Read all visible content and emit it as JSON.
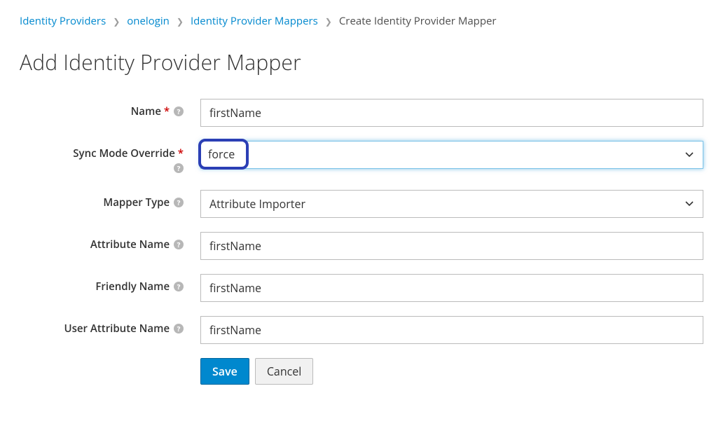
{
  "breadcrumb": {
    "items": [
      {
        "label": "Identity Providers",
        "link": true
      },
      {
        "label": "onelogin",
        "link": true
      },
      {
        "label": "Identity Provider Mappers",
        "link": true
      },
      {
        "label": "Create Identity Provider Mapper",
        "link": false
      }
    ]
  },
  "page": {
    "title": "Add Identity Provider Mapper"
  },
  "form": {
    "name": {
      "label": "Name",
      "value": "firstName"
    },
    "syncMode": {
      "label": "Sync Mode Override",
      "value": "force"
    },
    "mapperType": {
      "label": "Mapper Type",
      "value": "Attribute Importer"
    },
    "attributeName": {
      "label": "Attribute Name",
      "value": "firstName"
    },
    "friendlyName": {
      "label": "Friendly Name",
      "value": "firstName"
    },
    "userAttributeName": {
      "label": "User Attribute Name",
      "value": "firstName"
    }
  },
  "buttons": {
    "save": "Save",
    "cancel": "Cancel"
  }
}
